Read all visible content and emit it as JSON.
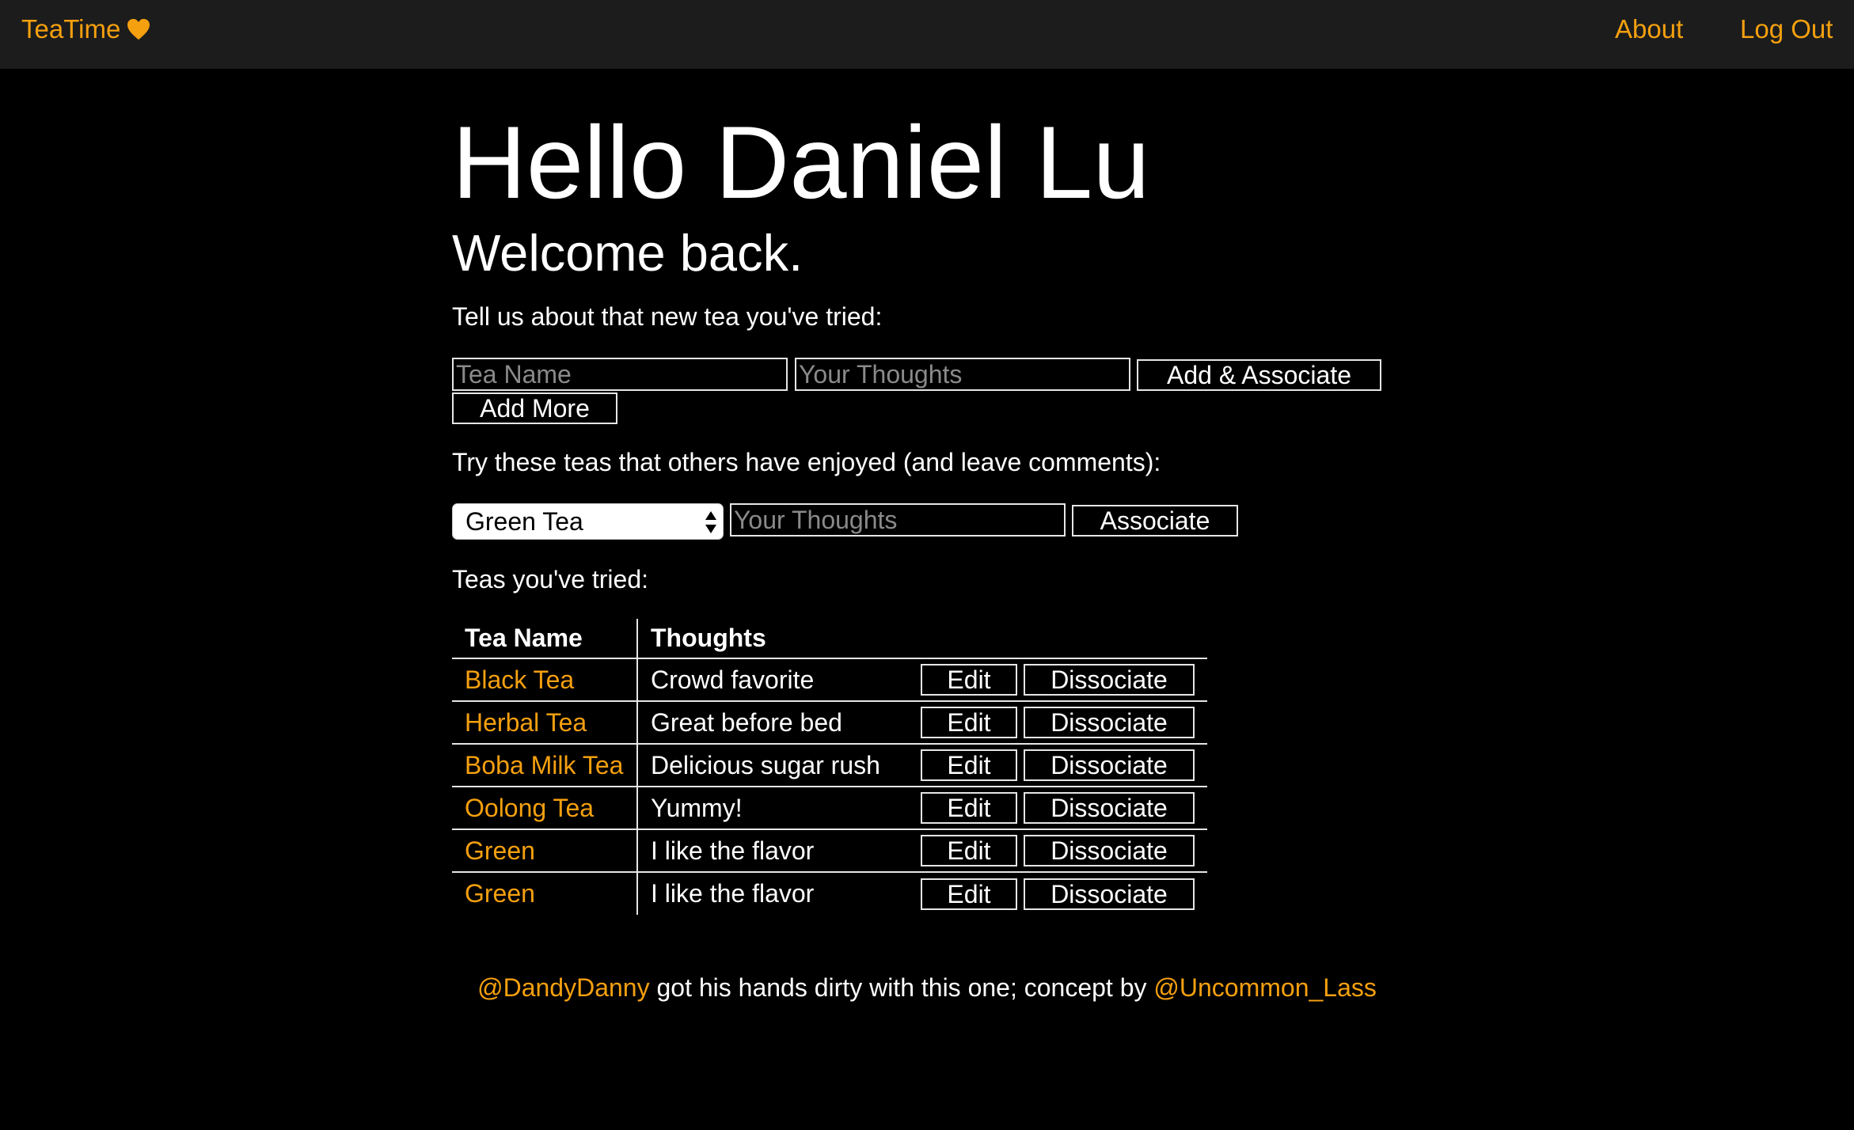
{
  "nav": {
    "brand": "TeaTime",
    "about": "About",
    "logout": "Log Out"
  },
  "greeting": {
    "hello": "Hello Daniel Lu",
    "welcome": "Welcome back."
  },
  "add_form": {
    "prompt": "Tell us about that new tea you've tried:",
    "tea_name_placeholder": "Tea Name",
    "thoughts_placeholder": "Your Thoughts",
    "submit_label": "Add & Associate",
    "add_more_label": "Add More"
  },
  "associate_form": {
    "prompt": "Try these teas that others have enjoyed (and leave comments):",
    "selected_tea": "Green Tea",
    "thoughts_placeholder": "Your Thoughts",
    "submit_label": "Associate"
  },
  "tried": {
    "heading": "Teas you've tried:",
    "columns": [
      "Tea Name",
      "Thoughts"
    ],
    "edit_label": "Edit",
    "dissociate_label": "Dissociate",
    "rows": [
      {
        "name": "Black Tea",
        "thoughts": "Crowd favorite"
      },
      {
        "name": "Herbal Tea",
        "thoughts": "Great before bed"
      },
      {
        "name": "Boba Milk Tea",
        "thoughts": "Delicious sugar rush"
      },
      {
        "name": "Oolong Tea",
        "thoughts": "Yummy!"
      },
      {
        "name": "Green",
        "thoughts": "I like the flavor"
      },
      {
        "name": "Green",
        "thoughts": "I like the flavor"
      }
    ]
  },
  "footer": {
    "author_handle": "@DandyDanny",
    "middle_text": " got his hands dirty with this one; concept by ",
    "concept_handle": "@Uncommon_Lass"
  },
  "colors": {
    "accent": "#f5a00f",
    "navbar_bg": "#1c1c1c",
    "page_bg": "#000000"
  },
  "icons": {
    "brand_icon": "heart-icon",
    "select_icon": "select-arrows-icon"
  }
}
